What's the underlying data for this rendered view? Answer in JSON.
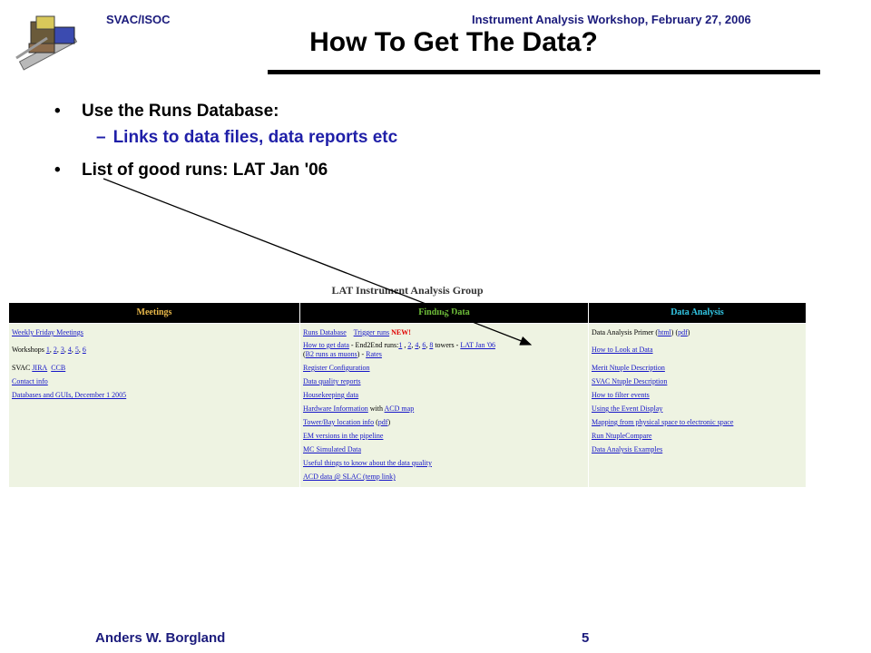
{
  "header": {
    "left": "SVAC/ISOC",
    "right": "Instrument Analysis Workshop,  February 27, 2006"
  },
  "title": "How To Get The Data?",
  "bullets": {
    "b1": "Use the Runs Database:",
    "b1_sub": "Links to data files, data reports etc",
    "b2": "List of good runs: LAT Jan '06"
  },
  "bullet_char": "•",
  "dash_char": "–",
  "webpage": {
    "title": "LAT Instrument Analysis Group",
    "columns": {
      "meetings": {
        "label": "Meetings",
        "color": "#e8b84a"
      },
      "finding": {
        "label": "Finding Data",
        "color": "#6fbf3a"
      },
      "analysis": {
        "label": "Data Analysis",
        "color": "#33c8e6"
      }
    },
    "meetings": {
      "weekly": "Weekly Friday Meetings",
      "workshops_prefix": "Workshops ",
      "ws1": "1",
      "ws2": "2",
      "ws3": "3",
      "ws4": "4",
      "ws5": "5",
      "ws6": "6",
      "svac_prefix": "SVAC ",
      "jira": "JIRA",
      "ccb": "CCB",
      "contact": "Contact info",
      "databases": "Databases and GUIs, December 1 2005"
    },
    "finding": {
      "runs_db": "Runs Database",
      "trigger_runs": "Trigger runs",
      "new": "NEW!",
      "how_to_get": "How to get data",
      "e2e_mid": " - End2End runs:",
      "r1": "1",
      "r2": "2",
      "r4": "4",
      "r6": "6",
      "r8": "8",
      "towers": " towers - ",
      "lat_jan": "LAT Jan '06",
      "b2_prefix": "(",
      "b2": "B2 runs as muons",
      "b2_mid": ") - ",
      "rates": "Rates",
      "register": "Register Configuration",
      "dq_reports": "Data quality reports",
      "housekeeping": "Housekeeping data",
      "hw_info": "Hardware Information",
      "with": " with ",
      "acd_map": "ACD map",
      "tower_bay": "Tower/Bay location info",
      "pdf_open": " (",
      "pdf": "pdf",
      "pdf_close": ")",
      "em_versions": "EM versions in the pipeline",
      "mc_sim": "MC Simulated Data",
      "useful": "Useful things to know about the data quality",
      "acd_data": "ACD data @ SLAC (temp link)"
    },
    "analysis": {
      "primer": "Data Analysis Primer (",
      "html": "html",
      "primer_mid": ") (",
      "pdf": "pdf",
      "primer_end": ")",
      "how_look": "How to Look at Data",
      "merit": "Merit Ntuple Description",
      "svac_ntuple": "SVAC Ntuple Description",
      "filter": "How to filter events",
      "event_display": "Using the Event Display",
      "mapping": "Mapping from physical space to electronic space",
      "ntuple_compare": "Run NtupleCompare",
      "examples": "Data Analysis Examples"
    }
  },
  "footer": {
    "author": "Anders W. Borgland",
    "page": "5"
  }
}
